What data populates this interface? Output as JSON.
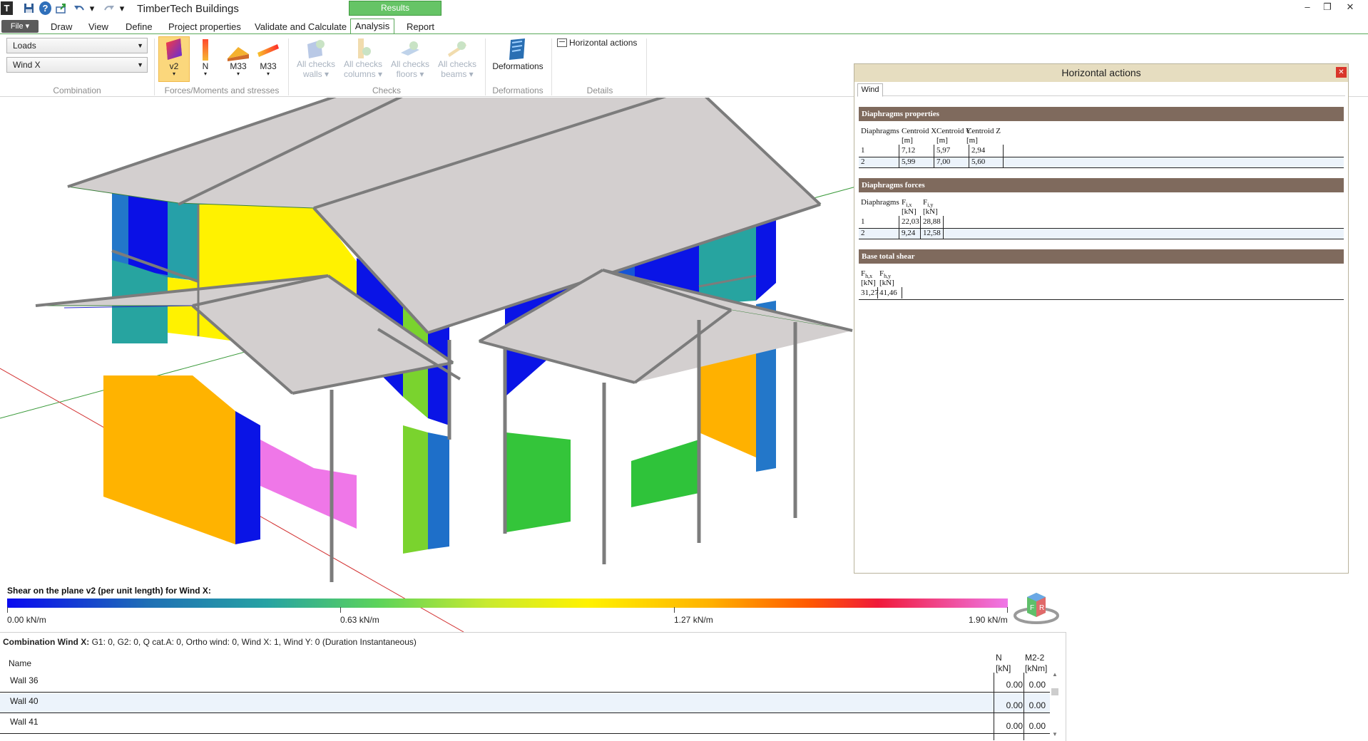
{
  "app": {
    "title": "TimberTech Buildings",
    "results_tab": "Results",
    "logo": "T",
    "icons": {
      "save": "save-icon",
      "help": "help-icon",
      "export": "export-icon",
      "undo": "undo-icon",
      "redo": "redo-icon"
    }
  },
  "menu": {
    "file": "File",
    "items": [
      "Draw",
      "View",
      "Define",
      "Project properties",
      "Validate and Calculate",
      "Analysis",
      "Report"
    ]
  },
  "ribbon": {
    "combination": {
      "loads": "Loads",
      "wind": "Wind X",
      "label": "Combination"
    },
    "forces": {
      "label": "Forces/Moments and stresses",
      "buttons": [
        "v2",
        "N",
        "M33",
        "M33"
      ]
    },
    "checks": {
      "label": "Checks",
      "buttons": [
        {
          "l1": "All checks",
          "l2": "walls"
        },
        {
          "l1": "All checks",
          "l2": "columns"
        },
        {
          "l1": "All checks",
          "l2": "floors"
        },
        {
          "l1": "All checks",
          "l2": "beams"
        }
      ]
    },
    "deformations": {
      "label": "Deformations",
      "button": "Deformations"
    },
    "details": {
      "label": "Details",
      "button": "Horizontal actions"
    }
  },
  "legend": {
    "title": "Shear on the plane v2 (per unit length) for Wind X:",
    "ticks": [
      "0.00 kN/m",
      "0.63 kN/m",
      "1.27 kN/m",
      "1.90 kN/m"
    ]
  },
  "bottom": {
    "combination_label": "Combination Wind X:",
    "combination_text": "G1: 0, G2: 0, Q cat.A: 0, Ortho wind: 0, Wind X: 1, Wind Y: 0 (Duration Instantaneous)",
    "col_name": "Name",
    "col_n": "N",
    "col_n_unit": "[kN]",
    "col_m": "M2-2",
    "col_m_unit": "[kNm]",
    "rows": [
      {
        "name": "Wall 36",
        "n": "0.00",
        "m": "0.00"
      },
      {
        "name": "Wall 40",
        "n": "0.00",
        "m": "0.00"
      },
      {
        "name": "Wall 41",
        "n": "0.00",
        "m": "0.00"
      }
    ]
  },
  "horizontal_actions": {
    "title": "Horizontal actions",
    "tab": "Wind",
    "diaphragm_props": {
      "heading": "Diaphragms properties",
      "headers": [
        "Diaphragms",
        "Centroid X",
        "Centroid Y",
        "Centroid Z"
      ],
      "units": [
        "[m]",
        "[m]",
        "[m]"
      ],
      "rows": [
        [
          "1",
          "7,12",
          "5,97",
          "2,94"
        ],
        [
          "2",
          "5,99",
          "7,00",
          "5,60"
        ]
      ]
    },
    "diaphragm_forces": {
      "heading": "Diaphragms forces",
      "headers": [
        "Diaphragms",
        "F",
        "F"
      ],
      "subs": [
        "i,x",
        "i,y"
      ],
      "units": [
        "[kN]",
        "[kN]"
      ],
      "rows": [
        [
          "1",
          "22,03",
          "28,88"
        ],
        [
          "2",
          "9,24",
          "12,58"
        ]
      ]
    },
    "base_shear": {
      "heading": "Base total shear",
      "headers": [
        "F",
        "F"
      ],
      "subs": [
        "h,x",
        "h,y"
      ],
      "units": [
        "[kN]",
        "[kN]"
      ],
      "values": [
        "31,27",
        "41,46"
      ]
    }
  }
}
